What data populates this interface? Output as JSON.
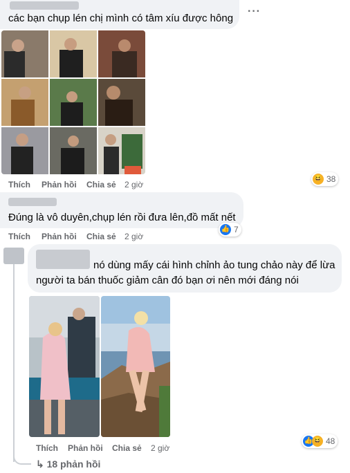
{
  "comment1": {
    "text": "các bạn chụp lén chị mình có tâm xíu được hông",
    "more": "···",
    "actions": {
      "like": "Thích",
      "reply": "Phản hồi",
      "share": "Chia sẻ",
      "time": "2 giờ"
    },
    "reaction_count": "38"
  },
  "comment2": {
    "text": "Đúng là vô duyên,chụp lén rồi đưa lên,đồ mất nết",
    "actions": {
      "like": "Thích",
      "reply": "Phản hồi",
      "share": "Chia sẻ",
      "time": "2 giờ"
    },
    "reaction_count": "7"
  },
  "comment3": {
    "text_line1": "nó dùng mấy cái hình chỉnh ảo tung chảo này để lừa",
    "text_line2": "người ta bán thuốc giảm cân đó bạn ơi nên mới đáng nói",
    "actions": {
      "like": "Thích",
      "reply": "Phản hồi",
      "share": "Chia sẻ",
      "time": "2 giờ"
    },
    "reaction_count": "48"
  },
  "replies_link": "↳ 18 phản hồi",
  "icons": {
    "haha": "haha-icon",
    "like": "like-icon",
    "more": "more-icon",
    "reply_arrow": "reply-arrow-icon"
  },
  "colors": {
    "bubble": "#f0f2f5",
    "secondary_text": "#65676b",
    "like_blue": "#1877f2",
    "haha_yellow": "#f7b125"
  }
}
